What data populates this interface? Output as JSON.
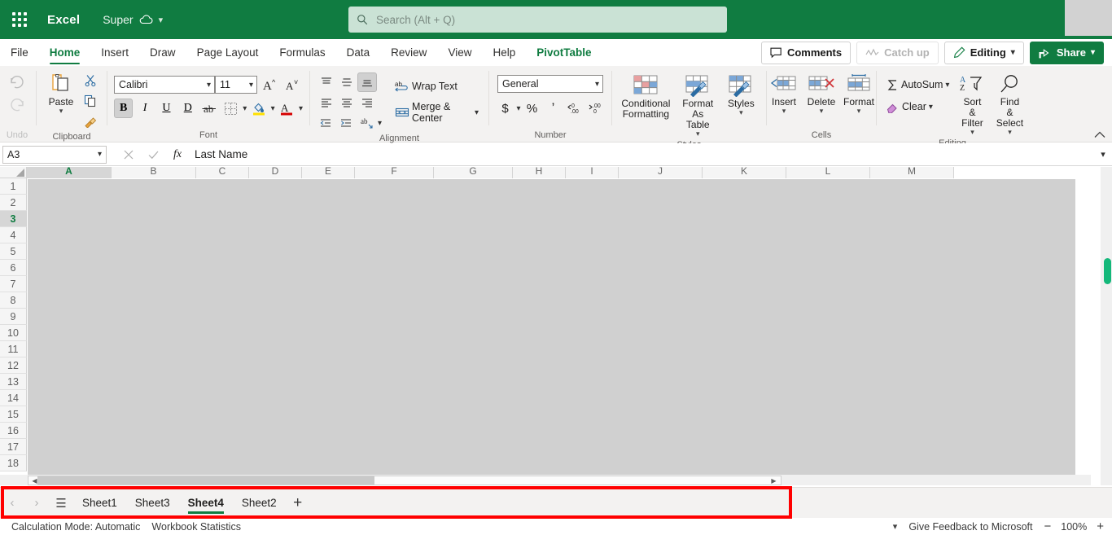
{
  "titlebar": {
    "app_name": "Excel",
    "doc_title": "Super",
    "waffle_icon": "app-launcher-icon",
    "cloud_icon": "cloud-saved-icon",
    "title_chevron": "chevron-down-icon",
    "search": {
      "placeholder": "Search (Alt + Q)",
      "value": "",
      "icon": "search-icon"
    }
  },
  "ribbon_tabs": {
    "items": [
      {
        "label": "File",
        "state": "normal"
      },
      {
        "label": "Home",
        "state": "selected"
      },
      {
        "label": "Insert",
        "state": "normal"
      },
      {
        "label": "Draw",
        "state": "normal"
      },
      {
        "label": "Page Layout",
        "state": "normal"
      },
      {
        "label": "Formulas",
        "state": "normal"
      },
      {
        "label": "Data",
        "state": "normal"
      },
      {
        "label": "Review",
        "state": "normal"
      },
      {
        "label": "View",
        "state": "normal"
      },
      {
        "label": "Help",
        "state": "normal"
      },
      {
        "label": "PivotTable",
        "state": "contextual"
      }
    ],
    "right_buttons": [
      {
        "label": "Comments",
        "icon": "comment-icon",
        "style": "normal"
      },
      {
        "label": "Catch up",
        "icon": "catchup-icon",
        "style": "disabled"
      },
      {
        "label": "Editing",
        "icon": "pencil-icon",
        "style": "normal",
        "chevron": "chevron-down-icon"
      },
      {
        "label": "Share",
        "icon": "share-icon",
        "style": "accent",
        "chevron": "chevron-down-icon"
      }
    ]
  },
  "ribbon": {
    "undo_group": {
      "label": "Undo",
      "undo_icon": "undo-arrow-icon",
      "redo_icon": "redo-arrow-icon"
    },
    "clipboard": {
      "label": "Clipboard",
      "paste_label": "Paste",
      "paste_icon": "clipboard-paste-icon",
      "cut_icon": "scissors-icon",
      "copy_icon": "copy-icon",
      "format_painter_icon": "format-painter-icon"
    },
    "font": {
      "label": "Font",
      "font_name": "Calibri",
      "font_size": "11",
      "grow_font_icon": "increase-font-size-icon",
      "shrink_font_icon": "decrease-font-size-icon",
      "bold": {
        "label": "B",
        "active": true
      },
      "italic": {
        "label": "I",
        "active": false
      },
      "underline": {
        "label": "U",
        "active": false
      },
      "double_underline": {
        "label": "D",
        "active": false
      },
      "strikethrough_icon": "strikethrough-icon",
      "borders_icon": "borders-icon",
      "fill_color_icon": "fill-color-icon",
      "font_color_icon": "font-color-icon"
    },
    "alignment": {
      "label": "Alignment",
      "wrap_text_label": "Wrap Text",
      "wrap_text_icon": "wrap-text-icon",
      "merge_center_label": "Merge & Center",
      "merge_center_icon": "merge-center-icon",
      "align_top_icon": "align-top-icon",
      "align_middle_icon": "align-middle-icon",
      "align_bottom_icon": "align-bottom-icon",
      "align_left_icon": "align-left-icon",
      "align_center_icon": "align-center-icon",
      "align_right_icon": "align-right-icon",
      "decrease_indent_icon": "decrease-indent-icon",
      "increase_indent_icon": "increase-indent-icon",
      "orientation_icon": "text-orientation-icon"
    },
    "number": {
      "label": "Number",
      "format": "General",
      "currency_icon": "currency-icon",
      "percent_icon": "percent-style-icon",
      "comma_icon": "comma-style-icon",
      "increase_decimal_icon": "increase-decimal-icon",
      "decrease_decimal_icon": "decrease-decimal-icon"
    },
    "styles": {
      "label": "Styles",
      "items": [
        {
          "label": "Conditional Formatting",
          "icon": "conditional-formatting-icon"
        },
        {
          "label": "Format As Table",
          "icon": "format-as-table-icon"
        },
        {
          "label": "Styles",
          "icon": "cell-styles-icon"
        }
      ]
    },
    "cells": {
      "label": "Cells",
      "items": [
        {
          "label": "Insert",
          "icon": "insert-cells-icon"
        },
        {
          "label": "Delete",
          "icon": "delete-cells-icon"
        },
        {
          "label": "Format",
          "icon": "format-cells-icon"
        }
      ]
    },
    "editing": {
      "label": "Editing",
      "autosum_label": "AutoSum",
      "autosum_icon": "sigma-icon",
      "clear_label": "Clear",
      "clear_icon": "eraser-icon",
      "sort_filter_label": "Sort & Filter",
      "sort_filter_icon": "sort-filter-icon",
      "find_select_label": "Find & Select",
      "find_select_icon": "magnifier-icon"
    },
    "collapse_icon": "collapse-ribbon-icon"
  },
  "formula_bar": {
    "name_box": "A3",
    "name_box_chevron": "chevron-down-icon",
    "cancel_icon": "cancel-x-icon",
    "enter_icon": "confirm-check-icon",
    "fx_icon": "insert-function-icon",
    "formula_value": "Last Name",
    "expand_icon": "expand-formula-bar-icon"
  },
  "grid": {
    "columns": [
      "A",
      "B",
      "C",
      "D",
      "E",
      "F",
      "G",
      "H",
      "I",
      "J",
      "K",
      "L",
      "M"
    ],
    "rows": [
      "1",
      "2",
      "3",
      "4",
      "5",
      "6",
      "7",
      "8",
      "9",
      "10",
      "11",
      "12",
      "13",
      "14",
      "15",
      "16",
      "17",
      "18"
    ],
    "active_column": "A",
    "active_row": "3",
    "vertical_scrollbar_color": "#14b87a"
  },
  "sheet_bar": {
    "prev_icon": "chevron-left-icon",
    "next_icon": "chevron-right-icon",
    "all_sheets_icon": "all-sheets-menu-icon",
    "tabs": [
      {
        "label": "Sheet1",
        "active": false
      },
      {
        "label": "Sheet3",
        "active": false
      },
      {
        "label": "Sheet4",
        "active": true
      },
      {
        "label": "Sheet2",
        "active": false
      }
    ],
    "add_sheet_icon": "add-sheet-plus-icon",
    "add_sheet_label": "+",
    "highlight_color": "#ff0000"
  },
  "status_bar": {
    "calculation_mode": "Calculation Mode: Automatic",
    "workbook_statistics": "Workbook Statistics",
    "options_chevron": "chevron-down-icon",
    "feedback": "Give Feedback to Microsoft",
    "zoom_out_icon": "zoom-out-minus-icon",
    "zoom_level": "100%",
    "zoom_in_icon": "zoom-in-plus-icon"
  }
}
